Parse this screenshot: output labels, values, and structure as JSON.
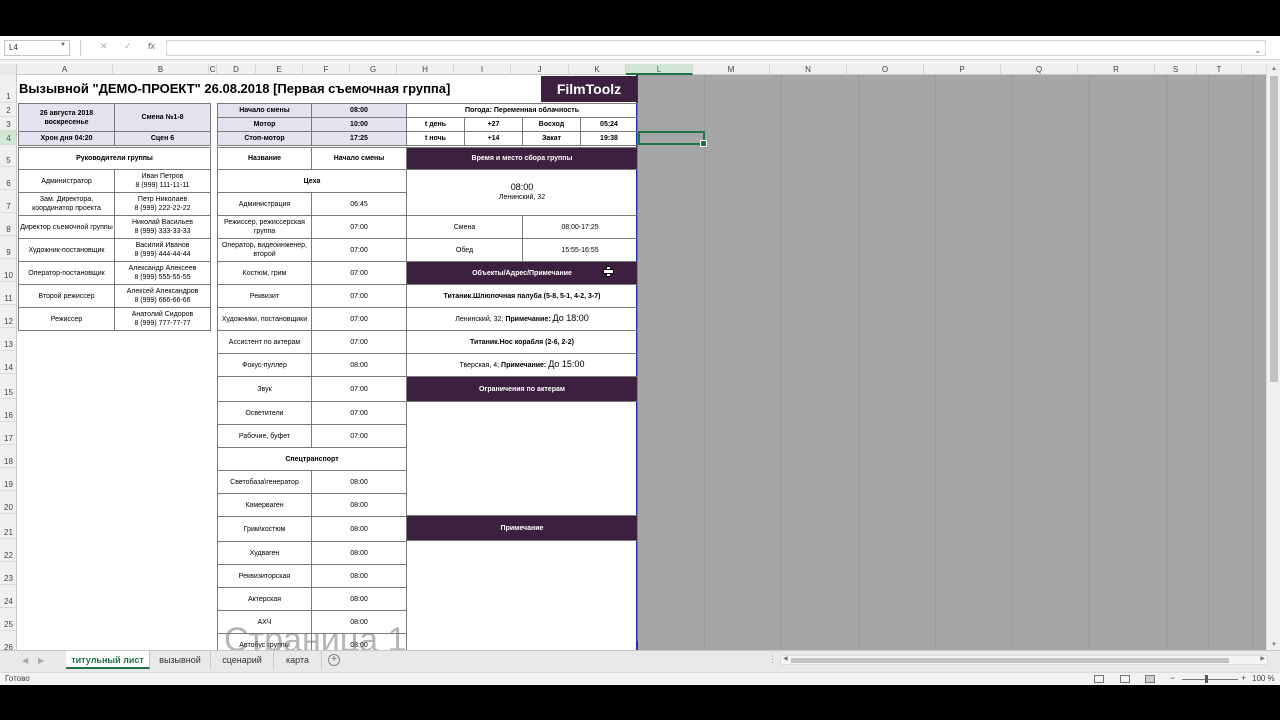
{
  "formula_bar": {
    "name_box": "L4",
    "cancel_icon": "✕",
    "enter_icon": "✓",
    "function_icon": "fx",
    "formula": ""
  },
  "columns": [
    "A",
    "B",
    "C",
    "D",
    "E",
    "F",
    "G",
    "H",
    "I",
    "J",
    "K",
    "L",
    "M",
    "N",
    "O",
    "P",
    "Q",
    "R",
    "S",
    "T"
  ],
  "selected_column": "L",
  "selected_row": "4",
  "rows": [
    "1",
    "2",
    "3",
    "4",
    "5",
    "6",
    "7",
    "8",
    "9",
    "10",
    "11",
    "12",
    "13",
    "14",
    "15",
    "16",
    "17",
    "18",
    "19",
    "20",
    "21",
    "22",
    "23",
    "24",
    "25",
    "26"
  ],
  "doc": {
    "title": "Вызывной \"ДЕМО-ПРОЕКТ\" 26.08.2018 [Первая съемочная группа]",
    "logo": "FilmToolz",
    "date_line1": "26 августа 2018",
    "date_line2": "воскресенье",
    "shift_num": "Смена №1-8",
    "chron": "Хрон дня 04:20",
    "scenes": "Сцен 6",
    "shift_times": [
      {
        "label": "Начало смены",
        "value": "08:00"
      },
      {
        "label": "Мотор",
        "value": "10:00"
      },
      {
        "label": "Стоп-мотор",
        "value": "17:25"
      }
    ],
    "weather": "Погода: Переменная облачность",
    "temps": [
      {
        "label": "t день",
        "value": "+27",
        "sun_label": "Восход",
        "sun_value": "05:24"
      },
      {
        "label": "t ночь",
        "value": "+14",
        "sun_label": "Закат",
        "sun_value": "19:38"
      }
    ],
    "leaders_header": "Руководители группы",
    "leaders": [
      {
        "role": "Администратор",
        "name": "Иван Петров",
        "phone": "8 (999) 111-11-11"
      },
      {
        "role": "Зам. Директора, координатор проекта",
        "name": "Петр Николаев",
        "phone": "8 (999) 222-22-22"
      },
      {
        "role": "Директор съемочной группы",
        "name": "Николай Васильев",
        "phone": "8 (999) 333-33-33"
      },
      {
        "role": "Художник-постановщик",
        "name": "Василий Иванов",
        "phone": "8 (999) 444-44-44"
      },
      {
        "role": "Оператор-постановщик",
        "name": "Александр Алексеев",
        "phone": "8 (999) 555-55-55"
      },
      {
        "role": "Второй режиссер",
        "name": "Алексей Александров",
        "phone": "8 (999) 666-66-66"
      },
      {
        "role": "Режиссер",
        "name": "Анатолий Сидоров",
        "phone": "8 (999) 777-77-77"
      }
    ],
    "dept_header_name": "Название",
    "dept_header_start": "Начало смены",
    "workshops_header": "Цеха",
    "workshops": [
      {
        "name": "Администрация",
        "time": "06:45"
      },
      {
        "name": "Режиссер, режиссерская группа",
        "time": "07:00"
      },
      {
        "name": "Оператор, видеоинженер, второй",
        "time": "07:00"
      },
      {
        "name": "Костюм, грим",
        "time": "07:00"
      },
      {
        "name": "Реквизит",
        "time": "07:00"
      },
      {
        "name": "Художники, постановщики",
        "time": "07:00"
      },
      {
        "name": "Ассистент по актерам",
        "time": "07:00"
      },
      {
        "name": "Фокус-пуллер",
        "time": "08:00"
      },
      {
        "name": "Звук",
        "time": "07:00"
      },
      {
        "name": "Осветители",
        "time": "07:00"
      },
      {
        "name": "Рабочие, буфет",
        "time": "07:00"
      }
    ],
    "transport_header": "Спецтранспорт",
    "transport": [
      {
        "name": "Светобаза\\генератор",
        "time": "08:00"
      },
      {
        "name": "Камерваген",
        "time": "08:00"
      },
      {
        "name": "Грим\\костюм",
        "time": "08:00"
      },
      {
        "name": "Худваген",
        "time": "08:00"
      },
      {
        "name": "Реквизиторская",
        "time": "08:00"
      },
      {
        "name": "Актерская",
        "time": "08:00"
      },
      {
        "name": "АХЧ",
        "time": "08:00"
      },
      {
        "name": "Автобус группы",
        "time": "08:00"
      }
    ],
    "gather_header": "Время и место сбора группы",
    "gather_time": "08:00",
    "gather_place": "Ленинский, 32",
    "shift_label": "Смена",
    "shift_value": "08:00-17:25",
    "lunch_label": "Обед",
    "lunch_value": "15:55-16:55",
    "objects_header": "Объекты/Адрес/Примечание",
    "obj1_title": "Титаник.Шлюпочная палуба (5-8, 5-1, 4-2, 3-7)",
    "obj1_addr": "Ленинский, 32;",
    "obj1_note_label": "Примечание:",
    "obj1_note": "До 18:00",
    "obj2_title": "Титаник.Нос корабля (2-6, 2-2)",
    "obj2_addr": "Тверская, 4;",
    "obj2_note_label": "Примечание:",
    "obj2_note": "До 15:00",
    "actors_header": "Ограничения по актерам",
    "notes_header": "Примечание"
  },
  "page_label": "Страница 1",
  "tabs": [
    {
      "label": "титульный лист",
      "active": true
    },
    {
      "label": "вызывной",
      "active": false
    },
    {
      "label": "сценарий",
      "active": false
    },
    {
      "label": "карта",
      "active": false
    }
  ],
  "status": {
    "ready": "Готово",
    "zoom": "100 %"
  }
}
